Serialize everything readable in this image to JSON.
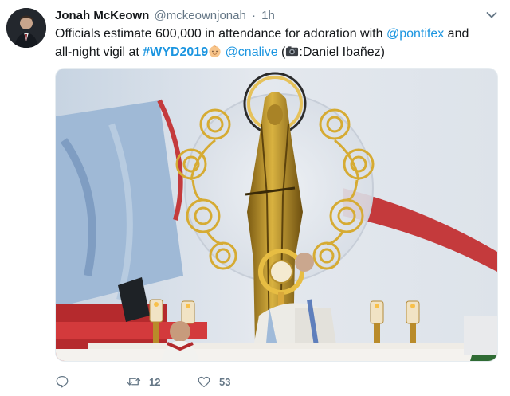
{
  "tweet": {
    "author_name": "Jonah McKeown",
    "author_handle": "@mckeownjonah",
    "separator": "·",
    "timestamp": "1h",
    "text_part1": "Officials estimate 600,000 in attendance for adoration with ",
    "mention1": "@pontifex",
    "text_part2": " and all-night vigil at ",
    "hashtag": "#WYD2019",
    "text_part3": " ",
    "mention2": "@cnalive",
    "text_part4": " (",
    "text_part5": ":Daniel Ibañez)",
    "icons": {
      "menu": "chevron-down-icon",
      "emoji1": "baby-face-emoji",
      "emoji2": "camera-emoji",
      "reply": "reply-icon",
      "retweet": "retweet-icon",
      "like": "heart-icon"
    }
  },
  "actions": {
    "reply_count": "",
    "retweet_count": "12",
    "like_count": "53"
  },
  "colors": {
    "link": "#1b95e0",
    "text": "#14171a",
    "muted": "#657786"
  }
}
